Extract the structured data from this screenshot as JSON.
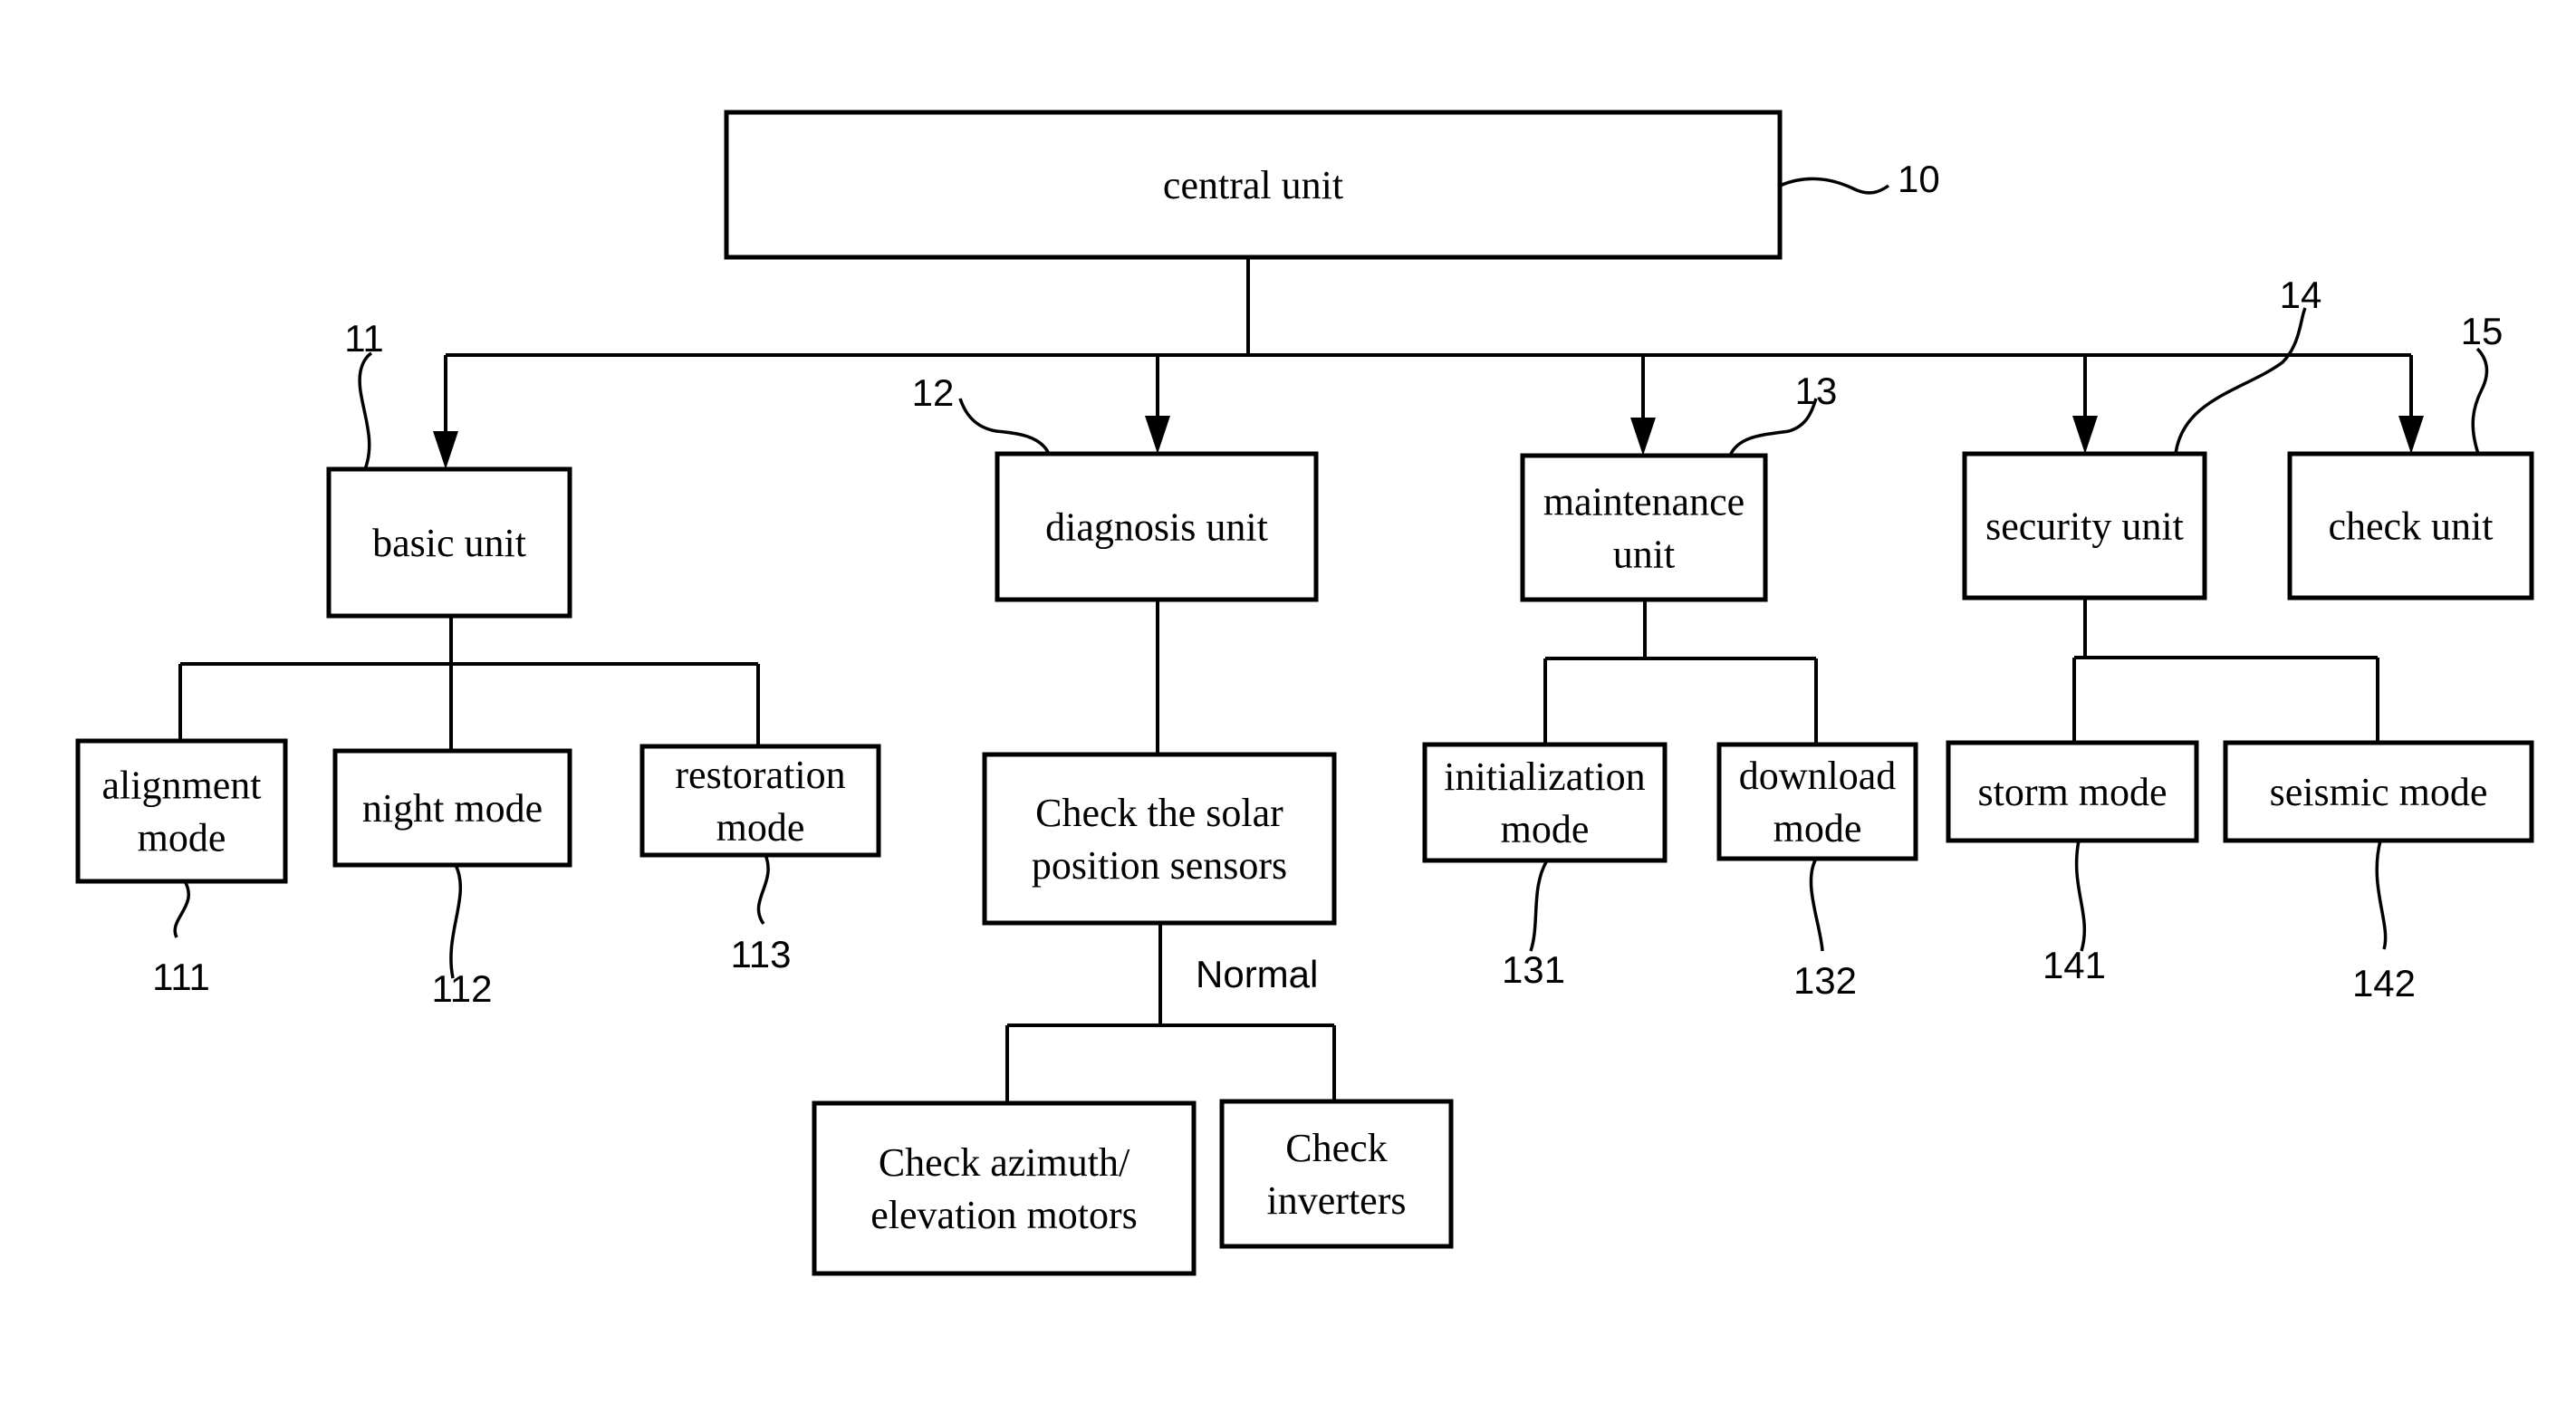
{
  "nodes": {
    "central": {
      "lines": [
        "central unit"
      ],
      "ref": "10"
    },
    "basic": {
      "lines": [
        "basic unit"
      ],
      "ref": "11"
    },
    "diagnosis": {
      "lines": [
        "diagnosis unit"
      ],
      "ref": "12"
    },
    "maintenance": {
      "lines": [
        "maintenance",
        "unit"
      ],
      "ref": "13"
    },
    "security": {
      "lines": [
        "security unit"
      ],
      "ref": "14"
    },
    "check": {
      "lines": [
        "check unit"
      ],
      "ref": "15"
    },
    "alignment": {
      "lines": [
        "alignment",
        "mode"
      ],
      "ref": "111"
    },
    "night": {
      "lines": [
        "night mode"
      ],
      "ref": "112"
    },
    "restoration": {
      "lines": [
        "restoration",
        "mode"
      ],
      "ref": "113"
    },
    "solar": {
      "lines": [
        "Check the solar",
        "position sensors"
      ]
    },
    "motors": {
      "lines": [
        "Check azimuth/",
        "elevation motors"
      ]
    },
    "inverters": {
      "lines": [
        "Check",
        "inverters"
      ]
    },
    "initialization": {
      "lines": [
        "initialization",
        "mode"
      ],
      "ref": "131"
    },
    "download": {
      "lines": [
        "download",
        "mode"
      ],
      "ref": "132"
    },
    "storm": {
      "lines": [
        "storm mode"
      ],
      "ref": "141"
    },
    "seismic": {
      "lines": [
        "seismic mode"
      ],
      "ref": "142"
    }
  },
  "edges": [
    {
      "from": "central",
      "to": "basic"
    },
    {
      "from": "central",
      "to": "diagnosis"
    },
    {
      "from": "central",
      "to": "maintenance"
    },
    {
      "from": "central",
      "to": "security"
    },
    {
      "from": "central",
      "to": "check"
    },
    {
      "from": "basic",
      "to": "alignment"
    },
    {
      "from": "basic",
      "to": "night"
    },
    {
      "from": "basic",
      "to": "restoration"
    },
    {
      "from": "diagnosis",
      "to": "solar"
    },
    {
      "from": "solar",
      "to": "motors",
      "label": "Normal"
    },
    {
      "from": "solar",
      "to": "inverters",
      "label": "Normal"
    },
    {
      "from": "maintenance",
      "to": "initialization"
    },
    {
      "from": "maintenance",
      "to": "download"
    },
    {
      "from": "security",
      "to": "storm"
    },
    {
      "from": "security",
      "to": "seismic"
    }
  ],
  "condition_label": "Normal"
}
